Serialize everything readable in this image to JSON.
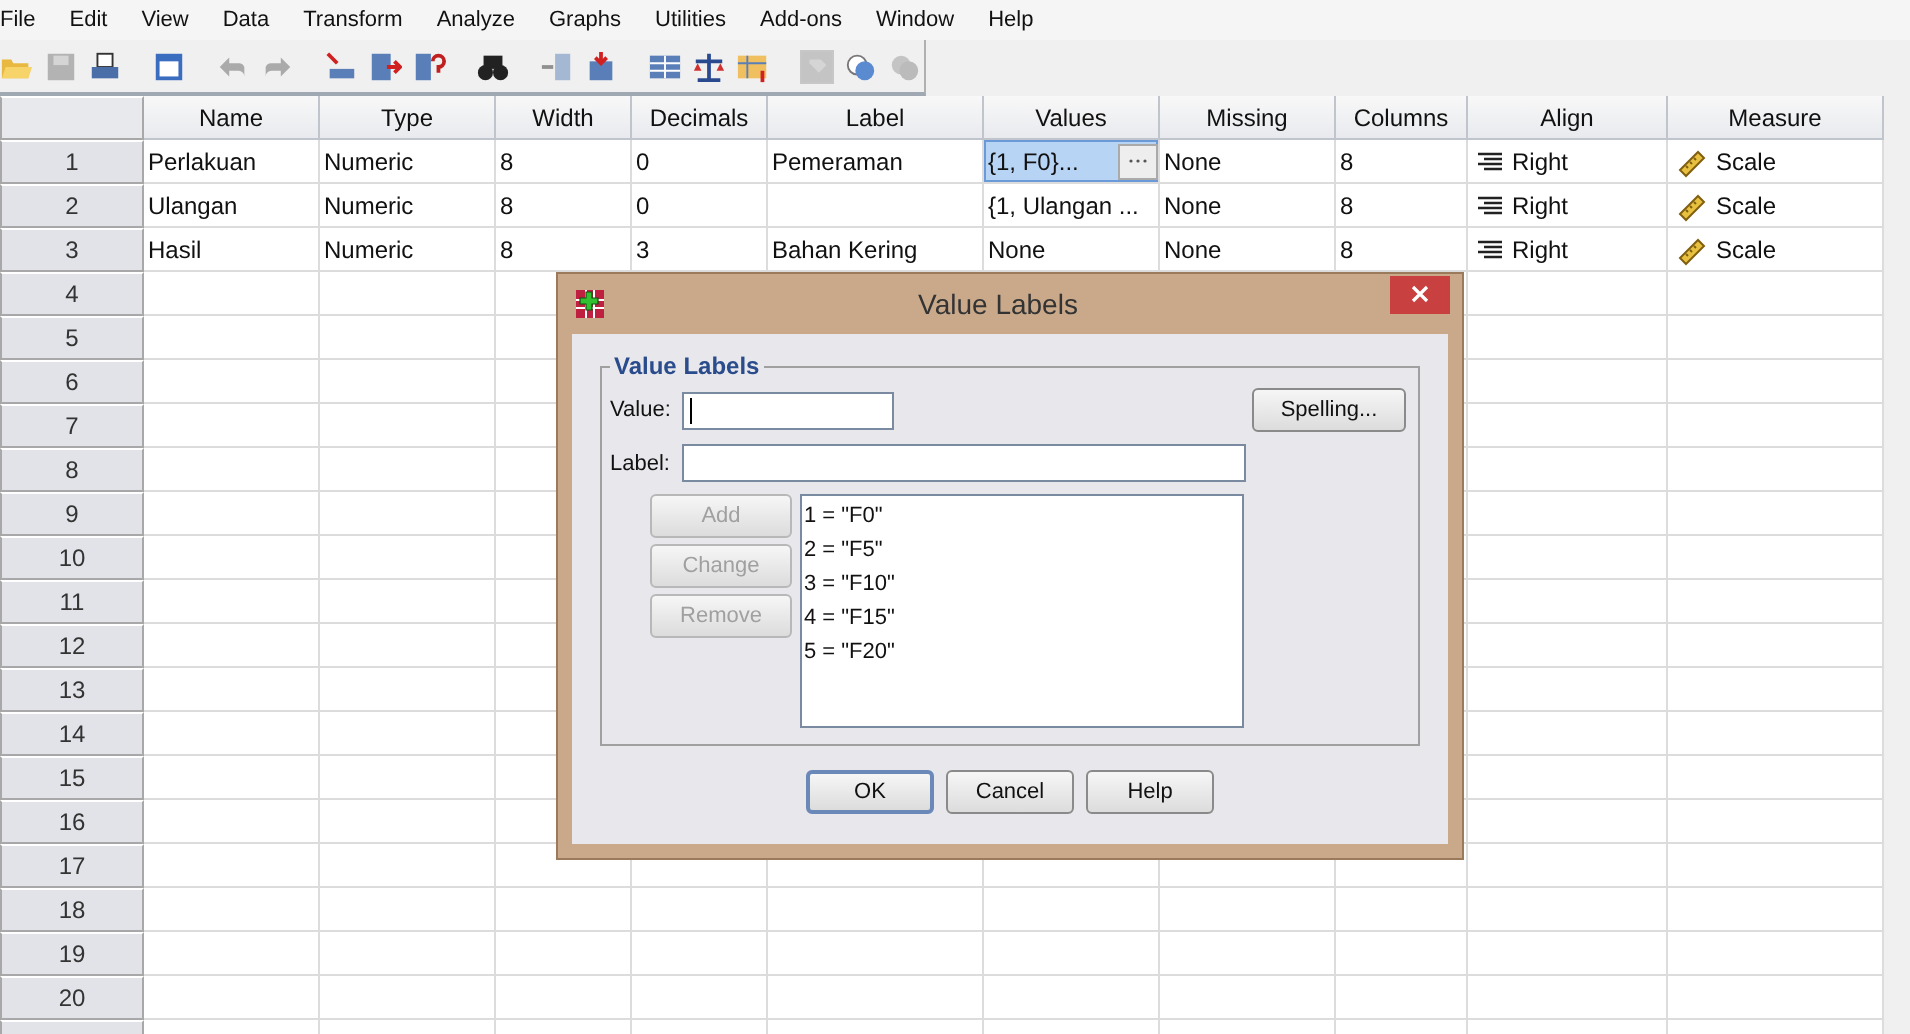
{
  "menu": [
    "File",
    "Edit",
    "View",
    "Data",
    "Transform",
    "Analyze",
    "Graphs",
    "Utilities",
    "Add-ons",
    "Window",
    "Help"
  ],
  "toolbar": [
    {
      "kind": "open",
      "disabled": false
    },
    {
      "kind": "save",
      "disabled": true
    },
    {
      "kind": "print",
      "disabled": false
    },
    {
      "kind": "sep"
    },
    {
      "kind": "recall",
      "disabled": false
    },
    {
      "kind": "sep"
    },
    {
      "kind": "undo",
      "disabled": true
    },
    {
      "kind": "redo",
      "disabled": true
    },
    {
      "kind": "sep"
    },
    {
      "kind": "gocase",
      "disabled": false
    },
    {
      "kind": "govar",
      "disabled": false
    },
    {
      "kind": "varinfo",
      "disabled": false
    },
    {
      "kind": "sep"
    },
    {
      "kind": "find",
      "disabled": false
    },
    {
      "kind": "sep"
    },
    {
      "kind": "inscase",
      "disabled": true
    },
    {
      "kind": "insvar",
      "disabled": false
    },
    {
      "kind": "sep"
    },
    {
      "kind": "split",
      "disabled": false
    },
    {
      "kind": "weight",
      "disabled": false
    },
    {
      "kind": "select",
      "disabled": false
    },
    {
      "kind": "sep"
    },
    {
      "kind": "labels",
      "disabled": true
    },
    {
      "kind": "sets",
      "disabled": false
    },
    {
      "kind": "showall",
      "disabled": true
    }
  ],
  "table": {
    "columns": [
      {
        "label": "Name",
        "kind": "text"
      },
      {
        "label": "Type",
        "kind": "text"
      },
      {
        "label": "Width",
        "kind": "text"
      },
      {
        "label": "Decimals",
        "kind": "text"
      },
      {
        "label": "Label",
        "kind": "text"
      },
      {
        "label": "Values",
        "kind": "values"
      },
      {
        "label": "Missing",
        "kind": "text"
      },
      {
        "label": "Columns",
        "kind": "text"
      },
      {
        "label": "Align",
        "kind": "align"
      },
      {
        "label": "Measure",
        "kind": "measure"
      }
    ],
    "row_numbers": [
      "1",
      "2",
      "3",
      "4",
      "5",
      "6",
      "7",
      "8",
      "9",
      "10",
      "11",
      "12",
      "13",
      "14",
      "15",
      "16",
      "17",
      "18",
      "19",
      "20"
    ],
    "rows": [
      {
        "cells": [
          {
            "text": "Perlakuan",
            "selected": false
          },
          {
            "text": "Numeric",
            "selected": false
          },
          {
            "text": "8",
            "selected": false
          },
          {
            "text": "0",
            "selected": false
          },
          {
            "text": "Pemeraman",
            "selected": false
          },
          {
            "text": "{1, F0}...",
            "selected": true
          },
          {
            "text": "None",
            "selected": false
          },
          {
            "text": "8",
            "selected": false
          },
          {
            "text": "Right",
            "selected": false
          },
          {
            "text": "Scale",
            "selected": false
          }
        ]
      },
      {
        "cells": [
          {
            "text": "Ulangan",
            "selected": false
          },
          {
            "text": "Numeric",
            "selected": false
          },
          {
            "text": "8",
            "selected": false
          },
          {
            "text": "0",
            "selected": false
          },
          {
            "selected": false
          },
          {
            "text": "{1, Ulangan ...",
            "selected": false
          },
          {
            "text": "None",
            "selected": false
          },
          {
            "text": "8",
            "selected": false
          },
          {
            "text": "Right",
            "selected": false
          },
          {
            "text": "Scale",
            "selected": false
          }
        ]
      },
      {
        "cells": [
          {
            "text": "Hasil",
            "selected": false
          },
          {
            "text": "Numeric",
            "selected": false
          },
          {
            "text": "8",
            "selected": false
          },
          {
            "text": "3",
            "selected": false
          },
          {
            "text": "Bahan Kering",
            "selected": false
          },
          {
            "text": "None",
            "selected": false
          },
          {
            "text": "None",
            "selected": false
          },
          {
            "text": "8",
            "selected": false
          },
          {
            "text": "Right",
            "selected": false
          },
          {
            "text": "Scale",
            "selected": false
          }
        ]
      }
    ]
  },
  "dialog": {
    "title": "Value Labels",
    "group_title": "Value Labels",
    "value_field": {
      "label": "Value:",
      "focused": true
    },
    "label_field": {
      "label": "Label:"
    },
    "spelling_button": "Spelling...",
    "side_buttons": [
      {
        "label": "Add",
        "disabled": true
      },
      {
        "label": "Change",
        "disabled": true
      },
      {
        "label": "Remove",
        "disabled": true
      }
    ],
    "list": [
      "1 = \"F0\"",
      "2 = \"F5\"",
      "3 = \"F10\"",
      "4 = \"F15\"",
      "5 = \"F20\""
    ],
    "buttons": [
      {
        "label": "OK",
        "default": true
      },
      {
        "label": "Cancel",
        "default": false
      },
      {
        "label": "Help",
        "default": false
      }
    ]
  }
}
